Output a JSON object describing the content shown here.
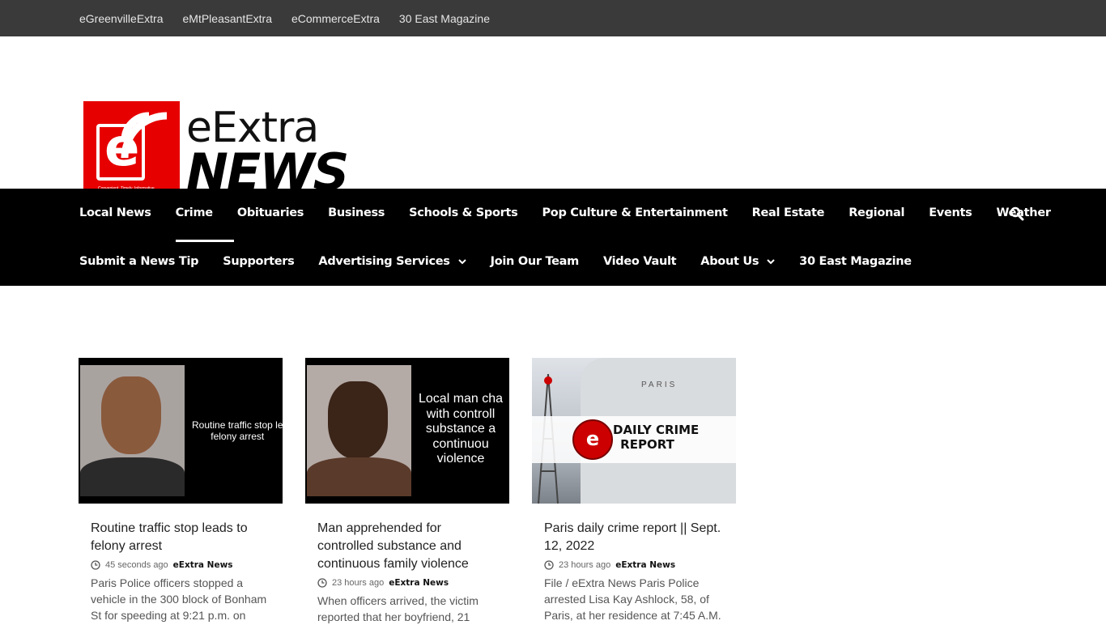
{
  "topbar": {
    "links": [
      "eGreenvilleExtra",
      "eMtPleasantExtra",
      "eCommerceExtra",
      "30 East Magazine"
    ]
  },
  "logo": {
    "line1": "eExtra",
    "line2": "NEWS",
    "letter": "e",
    "tagline": "Convenient. Timely. Informative."
  },
  "nav": {
    "row1": [
      "Local News",
      "Crime",
      "Obituaries",
      "Business",
      "Schools & Sports",
      "Pop Culture & Entertainment",
      "Real Estate",
      "Regional",
      "Events",
      "Weather"
    ],
    "row2": [
      "Submit a News Tip",
      "Supporters",
      "Advertising Services",
      "Join Our Team",
      "Video Vault",
      "About Us",
      "30 East Magazine"
    ],
    "active": "Crime"
  },
  "posts": [
    {
      "thumb_text": "Routine traffic stop le\nfelony arrest",
      "title": "Routine traffic stop leads to felony arrest",
      "time": "45 seconds ago",
      "author": "eExtra News",
      "excerpt": "Paris Police officers stopped a vehicle in the 300 block of Bonham St for speeding at 9:21 p.m. on"
    },
    {
      "thumb_text": "Local man cha\nwith controll\nsubstance a\ncontinuou\nviolence",
      "title": "Man apprehended for controlled substance and continuous family violence",
      "time": "23 hours ago",
      "author": "eExtra News",
      "excerpt": "When officers arrived, the victim reported that her boyfriend, 21"
    },
    {
      "thumb_text": "DAILY CRIME\nREPORT",
      "thumb_car_text": "PARIS",
      "title": "Paris daily crime report || Sept. 12, 2022",
      "time": "23 hours ago",
      "author": "eExtra News",
      "excerpt": "File / eExtra News Paris Police arrested Lisa Kay Ashlock, 58, of Paris, at her residence at 7:45 A.M."
    }
  ],
  "colors": {
    "topbar": "#3a3a3a",
    "nav": "#000000",
    "brand_red": "#e60000"
  }
}
